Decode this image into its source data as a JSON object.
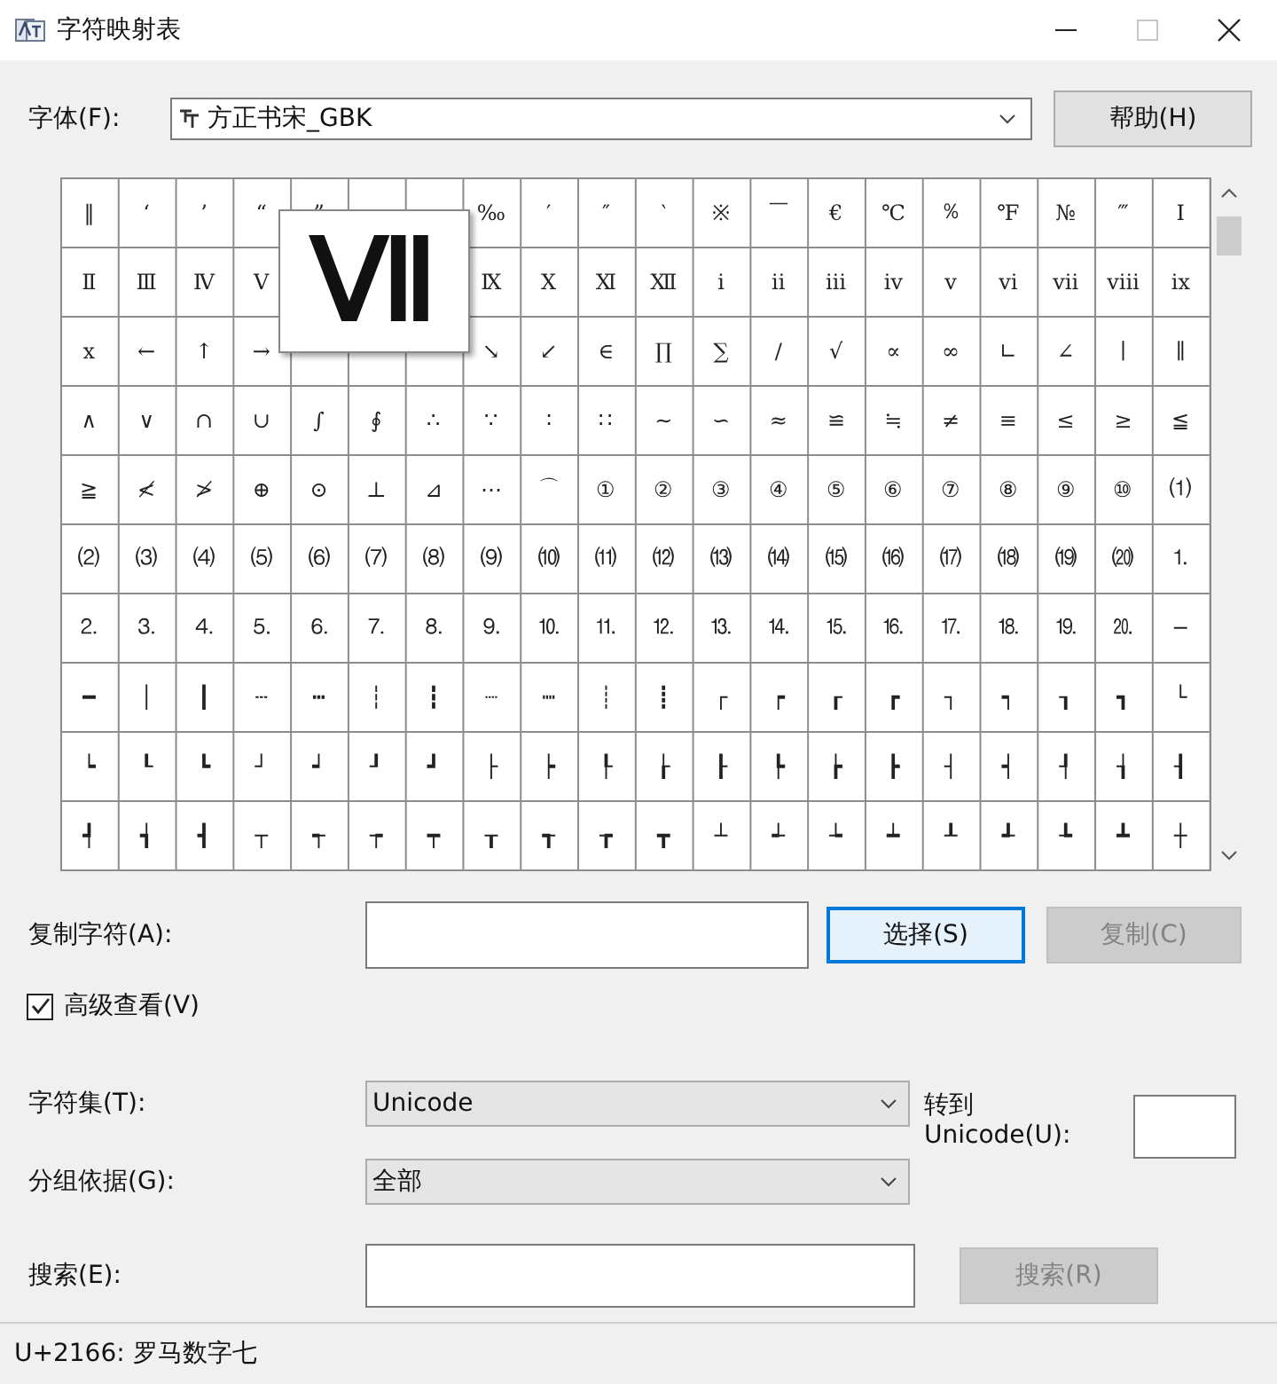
{
  "window": {
    "title": "字符映射表"
  },
  "font": {
    "label": "字体(F):",
    "value": "方正书宋_GBK"
  },
  "help_button": "帮助(H)",
  "grid": {
    "magnifier": "Ⅶ",
    "rows": [
      [
        "‖",
        "‘",
        "’",
        "“",
        "”",
        null,
        null,
        "‰",
        "′",
        "″",
        "‵",
        "※",
        "￣",
        "€",
        "℃",
        "％",
        "℉",
        "№",
        "‴",
        "Ⅰ"
      ],
      [
        "Ⅱ",
        "Ⅲ",
        "Ⅳ",
        "Ⅴ",
        null,
        null,
        null,
        "Ⅸ",
        "Ⅹ",
        "Ⅺ",
        "Ⅻ",
        "ⅰ",
        "ⅱ",
        "ⅲ",
        "ⅳ",
        "ⅴ",
        "ⅵ",
        "ⅶ",
        "ⅷ",
        "ⅸ"
      ],
      [
        "ⅹ",
        "←",
        "↑",
        "→",
        null,
        null,
        null,
        "↘",
        "↙",
        "∈",
        "∏",
        "∑",
        "∕",
        "√",
        "∝",
        "∞",
        "∟",
        "∠",
        "∣",
        "∥"
      ],
      [
        "∧",
        "∨",
        "∩",
        "∪",
        "∫",
        "∮",
        "∴",
        "∵",
        "∶",
        "∷",
        "∼",
        "∽",
        "≈",
        "≌",
        "≒",
        "≠",
        "≡",
        "≤",
        "≥",
        "≦"
      ],
      [
        "≧",
        "≮",
        "≯",
        "⊕",
        "⊙",
        "⊥",
        "⊿",
        "⋯",
        "⌒",
        "①",
        "②",
        "③",
        "④",
        "⑤",
        "⑥",
        "⑦",
        "⑧",
        "⑨",
        "⑩",
        "⑴"
      ],
      [
        "⑵",
        "⑶",
        "⑷",
        "⑸",
        "⑹",
        "⑺",
        "⑻",
        "⑼",
        "⑽",
        "⑾",
        "⑿",
        "⒀",
        "⒁",
        "⒂",
        "⒃",
        "⒄",
        "⒅",
        "⒆",
        "⒇",
        "⒈"
      ],
      [
        "⒉",
        "⒊",
        "⒋",
        "⒌",
        "⒍",
        "⒎",
        "⒏",
        "⒐",
        "⒑",
        "⒒",
        "⒓",
        "⒔",
        "⒕",
        "⒖",
        "⒗",
        "⒘",
        "⒙",
        "⒚",
        "⒛",
        "─"
      ],
      [
        "━",
        "│",
        "┃",
        "┄",
        "┅",
        "┆",
        "┇",
        "┈",
        "┉",
        "┊",
        "┋",
        "┌",
        "┍",
        "┎",
        "┏",
        "┐",
        "┑",
        "┒",
        "┓",
        "└"
      ],
      [
        "┕",
        "┖",
        "┗",
        "┘",
        "┙",
        "┚",
        "┛",
        "├",
        "┝",
        "┞",
        "┟",
        "┠",
        "┡",
        "┢",
        "┣",
        "┤",
        "┥",
        "┦",
        "┧",
        "┨"
      ],
      [
        "┩",
        "┪",
        "┫",
        "┬",
        "┭",
        "┮",
        "┯",
        "┰",
        "┱",
        "┲",
        "┳",
        "┴",
        "┵",
        "┶",
        "┷",
        "┸",
        "┹",
        "┺",
        "┻",
        "┼"
      ]
    ]
  },
  "copy": {
    "label": "复制字符(A):",
    "select_button": "选择(S)",
    "copy_button": {
      "label": "复制(C)",
      "disabled": true
    }
  },
  "advanced": {
    "label": "高级查看(V)",
    "checked": true
  },
  "charset": {
    "label": "字符集(T):",
    "value": "Unicode"
  },
  "goto": {
    "label": "转到 Unicode(U):"
  },
  "group_by": {
    "label": "分组依据(G):",
    "value": "全部"
  },
  "search": {
    "label": "搜索(E):",
    "button": {
      "label": "搜索(R)",
      "disabled": true
    }
  },
  "status_bar": "U+2166: 罗马数字七"
}
